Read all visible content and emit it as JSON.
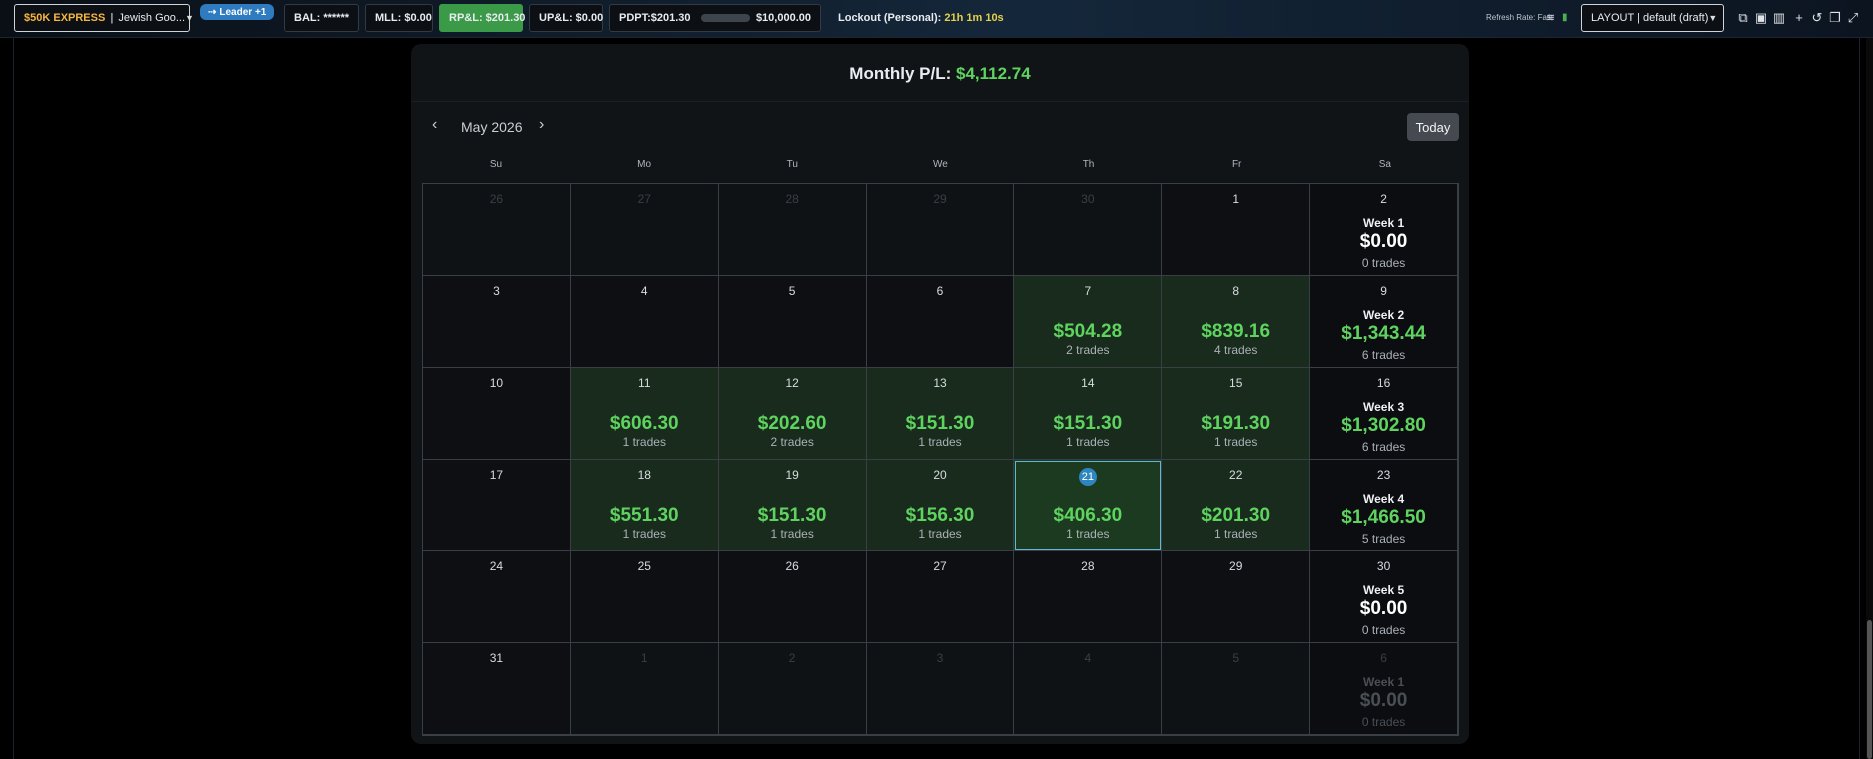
{
  "topbar": {
    "account_brand": "$50K EXPRESS",
    "account_sep": "|",
    "account_name": "Jewish Goo...",
    "leader": "Leader +1",
    "bal": "BAL: ******",
    "mll": "MLL: $0.00",
    "rpl": "RP&L: $201.30",
    "upl": "UP&L: $0.00",
    "pdpt_label": "PDPT:$201.30",
    "pdpt_target": "$10,000.00",
    "pdpt_progress": 0.02,
    "lockout_label": "Lockout (Personal):",
    "lockout_time": "21h 1m 10s",
    "refresh": "Refresh Rate: Fast",
    "layout": "LAYOUT | default (draft)"
  },
  "calendar": {
    "monthly_label": "Monthly P/L:",
    "monthly_value": "$4,112.74",
    "month": "May 2026",
    "today_button": "Today",
    "weekdays": [
      "Su",
      "Mo",
      "Tu",
      "We",
      "Th",
      "Fr",
      "Sa"
    ],
    "cells": [
      {
        "d": "26",
        "other": true
      },
      {
        "d": "27",
        "other": true
      },
      {
        "d": "28",
        "other": true
      },
      {
        "d": "29",
        "other": true
      },
      {
        "d": "30",
        "other": true
      },
      {
        "d": "1"
      },
      {
        "d": "2",
        "week": "Week 1",
        "wamt": "$0.00",
        "wtr": "0 trades"
      },
      {
        "d": "3"
      },
      {
        "d": "4"
      },
      {
        "d": "5"
      },
      {
        "d": "6"
      },
      {
        "d": "7",
        "amt": "$504.28",
        "tr": "2 trades"
      },
      {
        "d": "8",
        "amt": "$839.16",
        "tr": "4 trades"
      },
      {
        "d": "9",
        "week": "Week 2",
        "wamt": "$1,343.44",
        "wtr": "6 trades",
        "g": true
      },
      {
        "d": "10"
      },
      {
        "d": "11",
        "amt": "$606.30",
        "tr": "1 trades"
      },
      {
        "d": "12",
        "amt": "$202.60",
        "tr": "2 trades"
      },
      {
        "d": "13",
        "amt": "$151.30",
        "tr": "1 trades"
      },
      {
        "d": "14",
        "amt": "$151.30",
        "tr": "1 trades"
      },
      {
        "d": "15",
        "amt": "$191.30",
        "tr": "1 trades"
      },
      {
        "d": "16",
        "week": "Week 3",
        "wamt": "$1,302.80",
        "wtr": "6 trades",
        "g": true
      },
      {
        "d": "17"
      },
      {
        "d": "18",
        "amt": "$551.30",
        "tr": "1 trades"
      },
      {
        "d": "19",
        "amt": "$151.30",
        "tr": "1 trades"
      },
      {
        "d": "20",
        "amt": "$156.30",
        "tr": "1 trades"
      },
      {
        "d": "21",
        "amt": "$406.30",
        "tr": "1 trades",
        "today": true
      },
      {
        "d": "22",
        "amt": "$201.30",
        "tr": "1 trades"
      },
      {
        "d": "23",
        "week": "Week 4",
        "wamt": "$1,466.50",
        "wtr": "5 trades",
        "g": true
      },
      {
        "d": "24"
      },
      {
        "d": "25"
      },
      {
        "d": "26"
      },
      {
        "d": "27"
      },
      {
        "d": "28"
      },
      {
        "d": "29"
      },
      {
        "d": "30",
        "week": "Week 5",
        "wamt": "$0.00",
        "wtr": "0 trades"
      },
      {
        "d": "31"
      },
      {
        "d": "1",
        "other": true
      },
      {
        "d": "2",
        "other": true
      },
      {
        "d": "3",
        "other": true
      },
      {
        "d": "4",
        "other": true
      },
      {
        "d": "5",
        "other": true
      },
      {
        "d": "6",
        "other": true,
        "week": "Week 1",
        "wamt": "$0.00",
        "wtr": "0 trades",
        "dim": true
      }
    ]
  }
}
